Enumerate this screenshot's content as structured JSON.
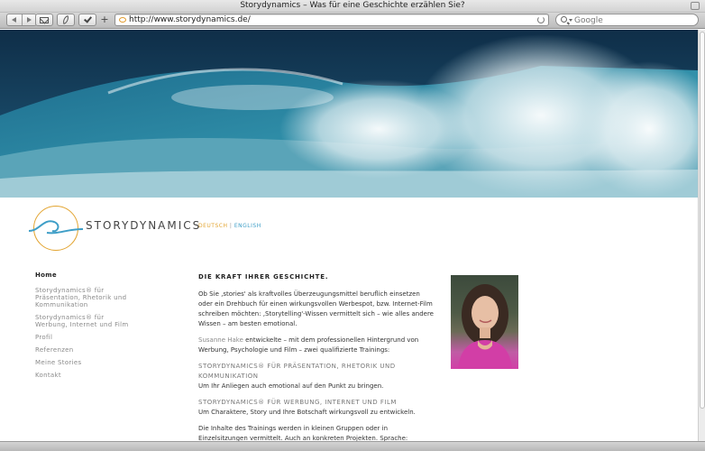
{
  "browser": {
    "window_title": "Storydynamics – Was für eine Geschichte erzählen Sie?",
    "url": "http://www.storydynamics.de/",
    "search_placeholder": "Google"
  },
  "site": {
    "brand": "STORYDYNAMICS",
    "languages": {
      "de": "DEUTSCH",
      "separator": "|",
      "en": "ENGLISH"
    },
    "nav": [
      {
        "label": "Home",
        "active": true
      },
      {
        "label": "Storydynamics® für Präsentation, Rhetorik und Kommunikation",
        "active": false
      },
      {
        "label": "Storydynamics® für Werbung, Internet und Film",
        "active": false
      },
      {
        "label": "Profil",
        "active": false
      },
      {
        "label": "Referenzen",
        "active": false
      },
      {
        "label": "Meine Stories",
        "active": false
      },
      {
        "label": "Kontakt",
        "active": false
      }
    ],
    "content": {
      "heading": "DIE KRAFT IHRER GESCHICHTE.",
      "para1": "Ob Sie ‚stories' als kraftvolles Überzeugungsmittel beruflich einsetzen oder ein Drehbuch für einen wirkungsvollen Werbespot, bzw. Internet-Film schreiben möchten: ‚Storytelling'-Wissen vermittelt sich – wie alles andere Wissen – am besten emotional.",
      "para2_name": "Susanne Hake",
      "para2_rest": " entwickelte – mit dem professionellen Hintergrund von Werbung, Psychologie und Film – zwei qualifizierte Trainings:",
      "training1_title": "STORYDYNAMICS® FÜR PRÄSENTATION, RHETORIK UND KOMMUNIKATION",
      "training1_text": "Um Ihr Anliegen auch emotional auf den Punkt zu bringen.",
      "training2_title": "STORYDYNAMICS® FÜR WERBUNG, INTERNET UND FILM",
      "training2_text": "Um Charaktere, Story und Ihre Botschaft wirkungsvoll zu entwickeln.",
      "para_last": "Die Inhalte des Trainings werden in kleinen Gruppen oder in Einzelsitzungen vermittelt. Auch an konkreten Projekten. Sprache:"
    }
  },
  "colors": {
    "accent_orange": "#e3a532",
    "accent_blue": "#3e9ec7",
    "ocean_dark": "#123b57",
    "ocean_light": "#7cb7c6"
  },
  "icons": [
    "back-icon",
    "forward-icon",
    "mail-icon",
    "feather-icon",
    "checkmark-icon",
    "plus-icon",
    "favicon",
    "reload-icon",
    "magnifier-icon"
  ]
}
